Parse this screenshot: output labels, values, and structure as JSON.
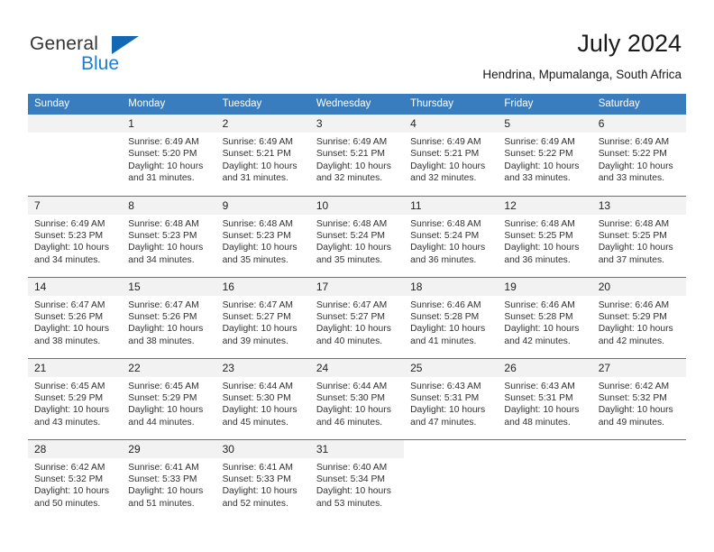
{
  "brand": {
    "name_part1": "General",
    "name_part2": "Blue",
    "triangle_color": "#1268b3",
    "blue_color": "#1a7fd4"
  },
  "header": {
    "title": "July 2024",
    "subtitle": "Hendrina, Mpumalanga, South Africa"
  },
  "theme": {
    "header_bg": "#3a7dbf",
    "daynum_bg": "#f2f2f2",
    "grid_line": "#3a7dbf",
    "text": "#303030"
  },
  "weekdays": [
    "Sunday",
    "Monday",
    "Tuesday",
    "Wednesday",
    "Thursday",
    "Friday",
    "Saturday"
  ],
  "days": {
    "d1": {
      "num": "1",
      "sunrise": "Sunrise: 6:49 AM",
      "sunset": "Sunset: 5:20 PM",
      "daylight1": "Daylight: 10 hours",
      "daylight2": "and 31 minutes."
    },
    "d2": {
      "num": "2",
      "sunrise": "Sunrise: 6:49 AM",
      "sunset": "Sunset: 5:21 PM",
      "daylight1": "Daylight: 10 hours",
      "daylight2": "and 31 minutes."
    },
    "d3": {
      "num": "3",
      "sunrise": "Sunrise: 6:49 AM",
      "sunset": "Sunset: 5:21 PM",
      "daylight1": "Daylight: 10 hours",
      "daylight2": "and 32 minutes."
    },
    "d4": {
      "num": "4",
      "sunrise": "Sunrise: 6:49 AM",
      "sunset": "Sunset: 5:21 PM",
      "daylight1": "Daylight: 10 hours",
      "daylight2": "and 32 minutes."
    },
    "d5": {
      "num": "5",
      "sunrise": "Sunrise: 6:49 AM",
      "sunset": "Sunset: 5:22 PM",
      "daylight1": "Daylight: 10 hours",
      "daylight2": "and 33 minutes."
    },
    "d6": {
      "num": "6",
      "sunrise": "Sunrise: 6:49 AM",
      "sunset": "Sunset: 5:22 PM",
      "daylight1": "Daylight: 10 hours",
      "daylight2": "and 33 minutes."
    },
    "d7": {
      "num": "7",
      "sunrise": "Sunrise: 6:49 AM",
      "sunset": "Sunset: 5:23 PM",
      "daylight1": "Daylight: 10 hours",
      "daylight2": "and 34 minutes."
    },
    "d8": {
      "num": "8",
      "sunrise": "Sunrise: 6:48 AM",
      "sunset": "Sunset: 5:23 PM",
      "daylight1": "Daylight: 10 hours",
      "daylight2": "and 34 minutes."
    },
    "d9": {
      "num": "9",
      "sunrise": "Sunrise: 6:48 AM",
      "sunset": "Sunset: 5:23 PM",
      "daylight1": "Daylight: 10 hours",
      "daylight2": "and 35 minutes."
    },
    "d10": {
      "num": "10",
      "sunrise": "Sunrise: 6:48 AM",
      "sunset": "Sunset: 5:24 PM",
      "daylight1": "Daylight: 10 hours",
      "daylight2": "and 35 minutes."
    },
    "d11": {
      "num": "11",
      "sunrise": "Sunrise: 6:48 AM",
      "sunset": "Sunset: 5:24 PM",
      "daylight1": "Daylight: 10 hours",
      "daylight2": "and 36 minutes."
    },
    "d12": {
      "num": "12",
      "sunrise": "Sunrise: 6:48 AM",
      "sunset": "Sunset: 5:25 PM",
      "daylight1": "Daylight: 10 hours",
      "daylight2": "and 36 minutes."
    },
    "d13": {
      "num": "13",
      "sunrise": "Sunrise: 6:48 AM",
      "sunset": "Sunset: 5:25 PM",
      "daylight1": "Daylight: 10 hours",
      "daylight2": "and 37 minutes."
    },
    "d14": {
      "num": "14",
      "sunrise": "Sunrise: 6:47 AM",
      "sunset": "Sunset: 5:26 PM",
      "daylight1": "Daylight: 10 hours",
      "daylight2": "and 38 minutes."
    },
    "d15": {
      "num": "15",
      "sunrise": "Sunrise: 6:47 AM",
      "sunset": "Sunset: 5:26 PM",
      "daylight1": "Daylight: 10 hours",
      "daylight2": "and 38 minutes."
    },
    "d16": {
      "num": "16",
      "sunrise": "Sunrise: 6:47 AM",
      "sunset": "Sunset: 5:27 PM",
      "daylight1": "Daylight: 10 hours",
      "daylight2": "and 39 minutes."
    },
    "d17": {
      "num": "17",
      "sunrise": "Sunrise: 6:47 AM",
      "sunset": "Sunset: 5:27 PM",
      "daylight1": "Daylight: 10 hours",
      "daylight2": "and 40 minutes."
    },
    "d18": {
      "num": "18",
      "sunrise": "Sunrise: 6:46 AM",
      "sunset": "Sunset: 5:28 PM",
      "daylight1": "Daylight: 10 hours",
      "daylight2": "and 41 minutes."
    },
    "d19": {
      "num": "19",
      "sunrise": "Sunrise: 6:46 AM",
      "sunset": "Sunset: 5:28 PM",
      "daylight1": "Daylight: 10 hours",
      "daylight2": "and 42 minutes."
    },
    "d20": {
      "num": "20",
      "sunrise": "Sunrise: 6:46 AM",
      "sunset": "Sunset: 5:29 PM",
      "daylight1": "Daylight: 10 hours",
      "daylight2": "and 42 minutes."
    },
    "d21": {
      "num": "21",
      "sunrise": "Sunrise: 6:45 AM",
      "sunset": "Sunset: 5:29 PM",
      "daylight1": "Daylight: 10 hours",
      "daylight2": "and 43 minutes."
    },
    "d22": {
      "num": "22",
      "sunrise": "Sunrise: 6:45 AM",
      "sunset": "Sunset: 5:29 PM",
      "daylight1": "Daylight: 10 hours",
      "daylight2": "and 44 minutes."
    },
    "d23": {
      "num": "23",
      "sunrise": "Sunrise: 6:44 AM",
      "sunset": "Sunset: 5:30 PM",
      "daylight1": "Daylight: 10 hours",
      "daylight2": "and 45 minutes."
    },
    "d24": {
      "num": "24",
      "sunrise": "Sunrise: 6:44 AM",
      "sunset": "Sunset: 5:30 PM",
      "daylight1": "Daylight: 10 hours",
      "daylight2": "and 46 minutes."
    },
    "d25": {
      "num": "25",
      "sunrise": "Sunrise: 6:43 AM",
      "sunset": "Sunset: 5:31 PM",
      "daylight1": "Daylight: 10 hours",
      "daylight2": "and 47 minutes."
    },
    "d26": {
      "num": "26",
      "sunrise": "Sunrise: 6:43 AM",
      "sunset": "Sunset: 5:31 PM",
      "daylight1": "Daylight: 10 hours",
      "daylight2": "and 48 minutes."
    },
    "d27": {
      "num": "27",
      "sunrise": "Sunrise: 6:42 AM",
      "sunset": "Sunset: 5:32 PM",
      "daylight1": "Daylight: 10 hours",
      "daylight2": "and 49 minutes."
    },
    "d28": {
      "num": "28",
      "sunrise": "Sunrise: 6:42 AM",
      "sunset": "Sunset: 5:32 PM",
      "daylight1": "Daylight: 10 hours",
      "daylight2": "and 50 minutes."
    },
    "d29": {
      "num": "29",
      "sunrise": "Sunrise: 6:41 AM",
      "sunset": "Sunset: 5:33 PM",
      "daylight1": "Daylight: 10 hours",
      "daylight2": "and 51 minutes."
    },
    "d30": {
      "num": "30",
      "sunrise": "Sunrise: 6:41 AM",
      "sunset": "Sunset: 5:33 PM",
      "daylight1": "Daylight: 10 hours",
      "daylight2": "and 52 minutes."
    },
    "d31": {
      "num": "31",
      "sunrise": "Sunrise: 6:40 AM",
      "sunset": "Sunset: 5:34 PM",
      "daylight1": "Daylight: 10 hours",
      "daylight2": "and 53 minutes."
    }
  }
}
